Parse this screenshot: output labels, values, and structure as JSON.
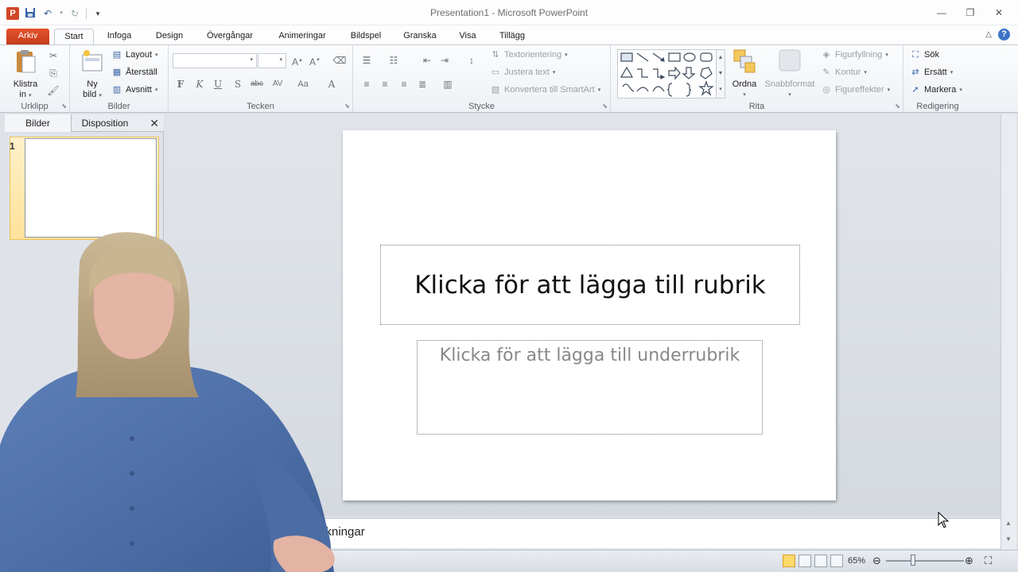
{
  "app": {
    "window_title": "Presentation1  -  Microsoft PowerPoint",
    "logo_letter": "P"
  },
  "tabs": {
    "file": "Arkiv",
    "items": [
      "Start",
      "Infoga",
      "Design",
      "Övergångar",
      "Animeringar",
      "Bildspel",
      "Granska",
      "Visa",
      "Tillägg"
    ]
  },
  "ribbon": {
    "clipboard": {
      "paste_line1": "Klistra",
      "paste_line2": "in",
      "label": "Urklipp"
    },
    "slides": {
      "new_line1": "Ny",
      "new_line2": "bild",
      "layout": "Layout",
      "reset": "Återställ",
      "section": "Avsnitt",
      "label": "Bilder"
    },
    "font": {
      "bold": "F",
      "italic": "K",
      "underline": "U",
      "shadow": "S",
      "strike": "abc",
      "spacing": "AV",
      "case": "Aa",
      "color": "A",
      "label": "Tecken"
    },
    "paragraph": {
      "text_direction": "Textorientering",
      "align_text": "Justera text",
      "smartart": "Konvertera till SmartArt",
      "label": "Stycke"
    },
    "drawing": {
      "arrange": "Ordna",
      "quick_styles": "Snabbformat",
      "fill": "Figurfyllning",
      "outline": "Kontur",
      "effects": "Figureffekter",
      "label": "Rita"
    },
    "editing": {
      "find": "Sök",
      "replace": "Ersätt",
      "select": "Markera",
      "label": "Redigering"
    }
  },
  "panel": {
    "tab_slides": "Bilder",
    "tab_outline": "Disposition",
    "close": "✕",
    "slide_number": "1"
  },
  "slide": {
    "title_placeholder": "Klicka för att lägga till rubrik",
    "subtitle_placeholder": "Klicka för att lägga till underrubrik"
  },
  "notes": {
    "visible_text": "ckningar"
  },
  "status": {
    "zoom_percent": "65%",
    "zoom_fraction": 0.35
  },
  "colors": {
    "file_tab": "#d24726",
    "accent_blue": "#3d73c4",
    "selected_thumb": "#ffe29a"
  }
}
